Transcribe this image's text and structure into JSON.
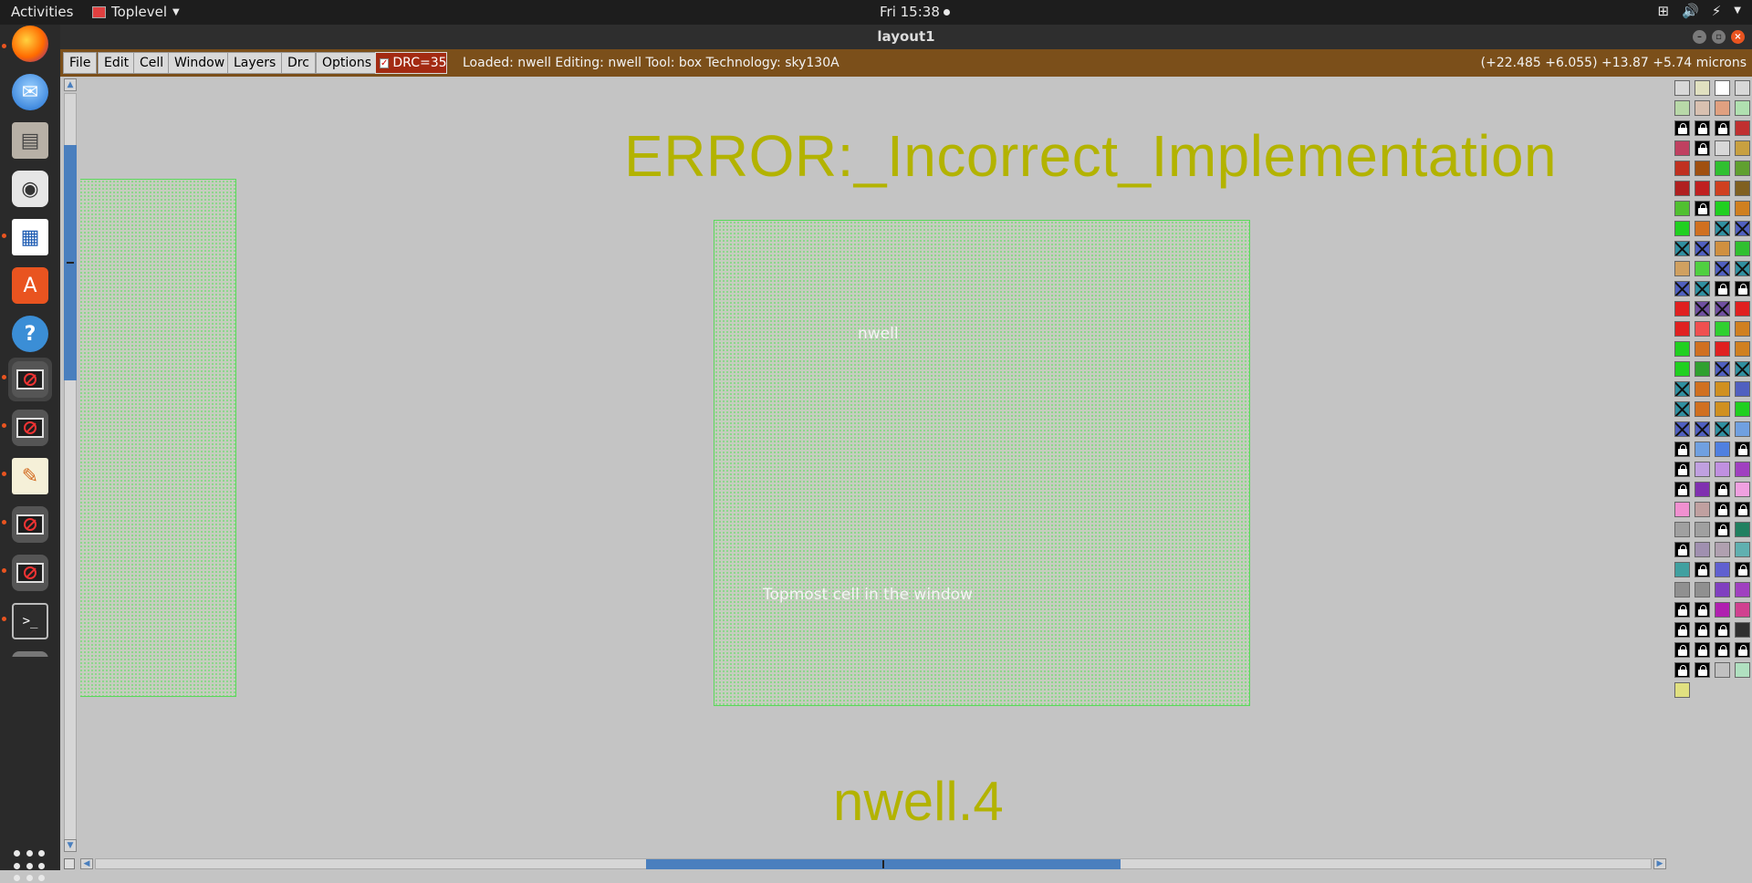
{
  "topbar": {
    "activities": "Activities",
    "app_name": "Toplevel",
    "clock": "Fri 15:38"
  },
  "window": {
    "title": "layout1"
  },
  "menu": {
    "items": [
      "File",
      "Edit",
      "Cell",
      "Window",
      "Layers",
      "Drc",
      "Options"
    ],
    "drc_label": "DRC=35",
    "status": "Loaded: nwell  Editing: nwell  Tool: box   Technology: sky130A",
    "coords": "(+22.485 +6.055) +13.87 +5.74 microns"
  },
  "canvas": {
    "error_text": "ERROR:_Incorrect_Implementation",
    "nwell_label": "nwell",
    "topmost_label": "Topmost cell in the window",
    "rule_label": "nwell.4"
  },
  "colors": {
    "menubar": "#7b4f1a",
    "drc_button": "#a32a12",
    "error_text": "#b3b300",
    "nwell_outline": "#5ad85a",
    "scroll_thumb": "#4a7fbe"
  },
  "dock": {
    "items": [
      "firefox-icon",
      "thunderbird-icon",
      "files-icon",
      "rhythmbox-icon",
      "writer-icon",
      "software-icon",
      "help-icon",
      "blocked-app-icon",
      "blocked-app-icon",
      "text-editor-icon",
      "blocked-app-icon",
      "blocked-app-icon",
      "terminal-icon"
    ]
  }
}
